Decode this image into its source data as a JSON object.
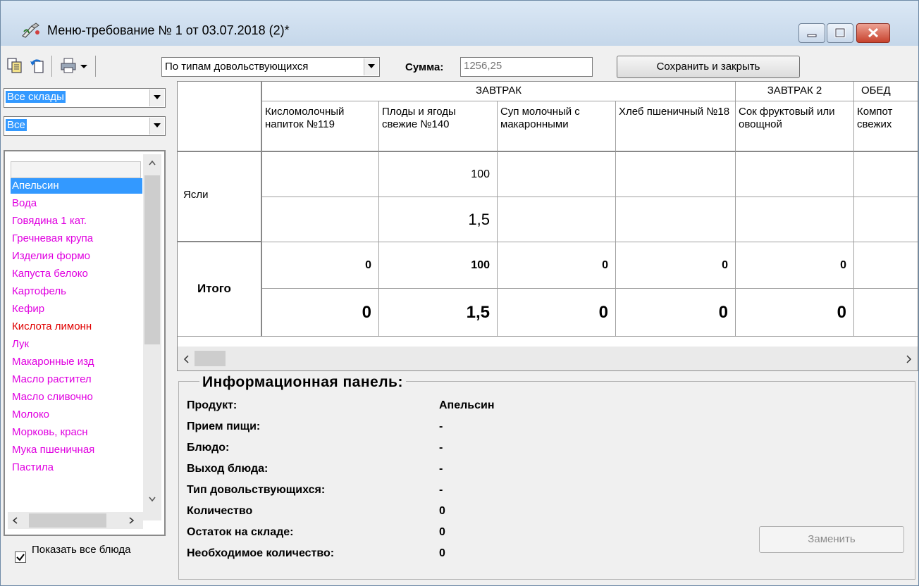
{
  "window": {
    "title": "Меню-требование № 1 от 03.07.2018 (2)*",
    "icons": [
      "app-icon",
      "minimize-icon",
      "maximize-icon",
      "close-icon"
    ]
  },
  "toolbar": {
    "copy_icon": "copy-icon",
    "undo_icon": "undo-icon",
    "print_icon": "print-icon",
    "group_combo": "По типам довольствующихся",
    "sum_label": "Сумма:",
    "sum_value": "1256,25",
    "save_close": "Сохранить и закрыть"
  },
  "left": {
    "warehouse": "Все склады",
    "category": "Все",
    "products": [
      {
        "name": "Апельсин",
        "color": "#ffffff",
        "selected": true
      },
      {
        "name": "Вода",
        "color": "#e000e0"
      },
      {
        "name": "Говядина 1 кат.",
        "color": "#e000e0"
      },
      {
        "name": "Гречневая крупа",
        "color": "#e000e0"
      },
      {
        "name": "Изделия формо",
        "color": "#e000e0"
      },
      {
        "name": "Капуста белоко",
        "color": "#e000e0"
      },
      {
        "name": "Картофель",
        "color": "#e000e0"
      },
      {
        "name": "Кефир",
        "color": "#e000e0"
      },
      {
        "name": "Кислота лимонн",
        "color": "#e00000"
      },
      {
        "name": "Лук",
        "color": "#e000e0"
      },
      {
        "name": "Макаронные изд",
        "color": "#e000e0"
      },
      {
        "name": "Масло растител",
        "color": "#e000e0"
      },
      {
        "name": "Масло сливочно",
        "color": "#e000e0"
      },
      {
        "name": "Молоко",
        "color": "#e000e0"
      },
      {
        "name": "Морковь, красн",
        "color": "#e000e0"
      },
      {
        "name": "Мука пшеничная",
        "color": "#e000e0"
      },
      {
        "name": "Пастила",
        "color": "#e000e0"
      }
    ],
    "show_all_label": "Показать все блюда",
    "show_all_checked": true
  },
  "grid": {
    "groups": [
      "ЗАВТРАК",
      "ЗАВТРАК 2",
      "ОБЕД"
    ],
    "dishes": [
      "Кисломолочный напиток №119",
      "Плоды и ягоды свежие №140",
      "Суп молочный с макаронными",
      "Хлеб пшеничный №18",
      "Сок фруктовый или овощной",
      "Компот свежих"
    ],
    "row1_label": "Ясли",
    "row1_top": [
      "",
      "100",
      "",
      "",
      "",
      ""
    ],
    "row1_bottom": [
      "",
      "1,5",
      "",
      "",
      "",
      ""
    ],
    "total_label": "Итого",
    "total_top": [
      "0",
      "100",
      "0",
      "0",
      "0",
      ""
    ],
    "total_bottom": [
      "0",
      "1,5",
      "0",
      "0",
      "0",
      ""
    ]
  },
  "info": {
    "title": "Информационная панель:",
    "rows": [
      {
        "label": "Продукт:",
        "value": "Апельсин"
      },
      {
        "label": "Прием пищи:",
        "value": "-"
      },
      {
        "label": "Блюдо:",
        "value": "-"
      },
      {
        "label": "Выход блюда:",
        "value": "-"
      },
      {
        "label": "Тип довольствующихся:",
        "value": "-"
      },
      {
        "label": "Количество",
        "value": "0"
      },
      {
        "label": "Остаток на складе:",
        "value": "0"
      },
      {
        "label": "Необходимое количество:",
        "value": "0"
      }
    ],
    "replace_button": "Заменить"
  }
}
